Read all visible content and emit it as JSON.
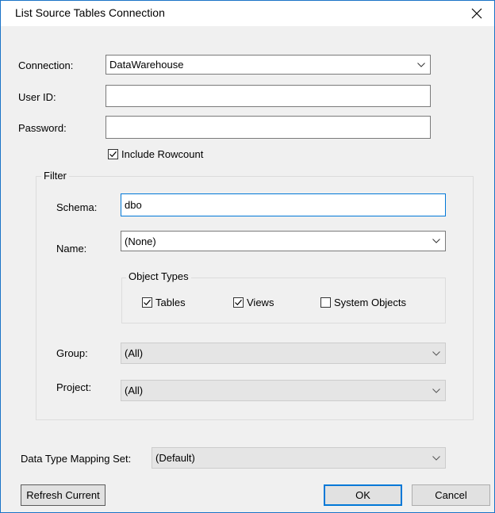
{
  "dialog": {
    "title": "List Source Tables Connection",
    "close_icon": "close-icon"
  },
  "connection": {
    "label": "Connection:",
    "value": "DataWarehouse"
  },
  "user_id": {
    "label": "User ID:",
    "value": ""
  },
  "password": {
    "label": "Password:",
    "value": ""
  },
  "include_rowcount": {
    "label": "Include Rowcount",
    "checked": true
  },
  "filter": {
    "legend": "Filter",
    "schema": {
      "label": "Schema:",
      "value": "dbo"
    },
    "name": {
      "label": "Name:",
      "value": "(None)"
    },
    "object_types": {
      "legend": "Object Types",
      "tables": {
        "label": "Tables",
        "checked": true
      },
      "views": {
        "label": "Views",
        "checked": true
      },
      "system_objects": {
        "label": "System Objects",
        "checked": false
      }
    },
    "group": {
      "label": "Group:",
      "value": "(All)"
    },
    "project": {
      "label": "Project:",
      "value": "(All)"
    }
  },
  "data_type_mapping": {
    "label": "Data Type Mapping Set:",
    "value": "(Default)"
  },
  "buttons": {
    "refresh": "Refresh Current",
    "ok": "OK",
    "cancel": "Cancel"
  },
  "colors": {
    "accent": "#0078d7",
    "disabled_bg": "#e5e5e5"
  }
}
